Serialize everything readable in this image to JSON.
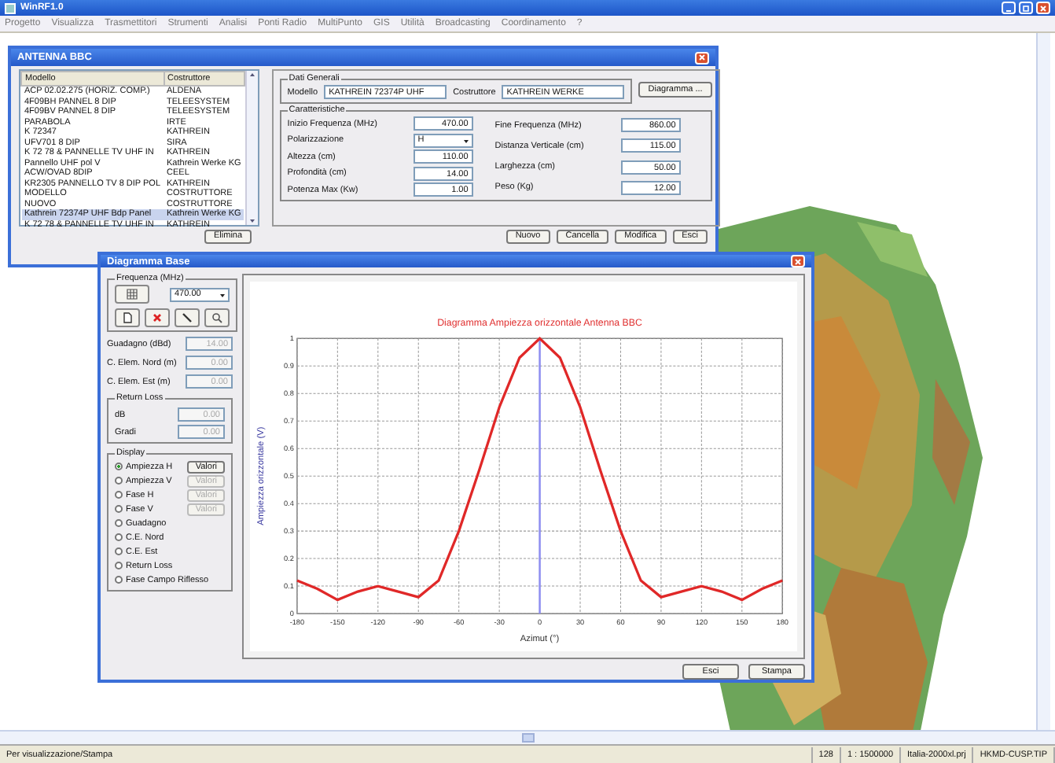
{
  "app": {
    "title": "WinRF1.0",
    "menu": [
      "Progetto",
      "Visualizza",
      "Trasmettitori",
      "Strumenti",
      "Analisi",
      "Ponti Radio",
      "MultiPunto",
      "GIS",
      "Utilità",
      "Broadcasting",
      "Coordinamento",
      "?"
    ]
  },
  "antenna_dialog": {
    "title": "ANTENNA BBC",
    "list": {
      "columns": [
        "Modello",
        "Costruttore"
      ],
      "rows": [
        {
          "cells": [
            "ACP 02.02.275 (HORIZ. COMP.)",
            "ALDENA"
          ],
          "selected": false
        },
        {
          "cells": [
            "4F09BH PANNEL 8 DIP",
            "TELEESYSTEM"
          ],
          "selected": false
        },
        {
          "cells": [
            "4F09BV PANNEL 8 DIP",
            "TELEESYSTEM"
          ],
          "selected": false
        },
        {
          "cells": [
            "PARABOLA",
            "IRTE"
          ],
          "selected": false
        },
        {
          "cells": [
            "K 72347",
            "KATHREIN"
          ],
          "selected": false
        },
        {
          "cells": [
            "UFV701 8 DIP",
            "SIRA"
          ],
          "selected": false
        },
        {
          "cells": [
            "K 72 78 & PANNELLE TV UHF IN",
            "KATHREIN"
          ],
          "selected": false
        },
        {
          "cells": [
            "Pannello UHF pol V",
            "Kathrein Werke KG"
          ],
          "selected": false
        },
        {
          "cells": [
            "ACW/OVAD 8DIP",
            "CEEL"
          ],
          "selected": false
        },
        {
          "cells": [
            "KR2305 PANNELLO TV 8 DIP POL",
            "KATHREIN"
          ],
          "selected": false
        },
        {
          "cells": [
            "MODELLO",
            "COSTRUTTORE"
          ],
          "selected": false
        },
        {
          "cells": [
            "NUOVO",
            "COSTRUTTORE"
          ],
          "selected": false
        },
        {
          "cells": [
            "Kathrein 72374P UHF Bdp Panel",
            "Kathrein Werke KG"
          ],
          "selected": true
        },
        {
          "cells": [
            "K 72 78 & PANNELLE TV UHF IN",
            "KATHREIN"
          ],
          "selected": false
        }
      ]
    },
    "dati_generali": {
      "legend": "Dati Generali",
      "fields": [
        {
          "label": "Modello",
          "value": "KATHREIN 72374P UHF"
        },
        {
          "label": "Costruttore",
          "value": "KATHREIN WERKE"
        }
      ]
    },
    "diagram_button": "Diagramma ...",
    "caratteristiche": {
      "legend": "Caratteristiche",
      "left": [
        {
          "label": "Inizio Frequenza (MHz)",
          "value": "470.00",
          "kind": "text"
        },
        {
          "label": "Polarizzazione",
          "value": "H",
          "kind": "dropdown"
        },
        {
          "label": "Altezza (cm)",
          "value": "110.00",
          "kind": "text"
        },
        {
          "label": "Profondità (cm)",
          "value": "14.00",
          "kind": "text"
        },
        {
          "label": "Potenza Max (Kw)",
          "value": "1.00",
          "kind": "text"
        }
      ],
      "right": [
        {
          "label": "Fine Frequenza (MHz)",
          "value": "860.00",
          "kind": "text"
        },
        {
          "label": "Distanza Verticale (cm)",
          "value": "115.00",
          "kind": "text"
        },
        {
          "label": "Larghezza (cm)",
          "value": "50.00",
          "kind": "text"
        },
        {
          "label": "Peso (Kg)",
          "value": "12.00",
          "kind": "text"
        }
      ]
    },
    "list_button": "Elimina",
    "buttons": [
      "Nuovo",
      "Cancella",
      "Modifica",
      "Esci"
    ]
  },
  "diagram_dialog": {
    "title": "Diagramma Base",
    "frequency": {
      "legend": "Frequenza (MHz)",
      "value": "470.00"
    },
    "params": [
      {
        "label": "Guadagno (dBd)",
        "value": "14.00",
        "disabled": true
      },
      {
        "label": "C. Elem. Nord (m)",
        "value": "0.00",
        "disabled": true
      },
      {
        "label": "C. Elem. Est (m)",
        "value": "0.00",
        "disabled": true
      }
    ],
    "return_loss": {
      "legend": "Return Loss",
      "fields": [
        {
          "label": "dB",
          "value": "0.00",
          "disabled": true
        },
        {
          "label": "Gradi",
          "value": "0.00",
          "disabled": true
        }
      ]
    },
    "display": {
      "legend": "Display",
      "options": [
        {
          "label": "Ampiezza H",
          "selected": true,
          "button": {
            "label": "Valori",
            "disabled": false
          }
        },
        {
          "label": "Ampiezza V",
          "selected": false,
          "button": {
            "label": "Valori",
            "disabled": true
          }
        },
        {
          "label": "Fase H",
          "selected": false,
          "button": {
            "label": "Valori",
            "disabled": true
          }
        },
        {
          "label": "Fase V",
          "selected": false,
          "button": {
            "label": "Valori",
            "disabled": true
          }
        },
        {
          "label": "Guadagno",
          "selected": false
        },
        {
          "label": "C.E. Nord",
          "selected": false
        },
        {
          "label": "C.E. Est",
          "selected": false
        },
        {
          "label": "Return Loss",
          "selected": false
        },
        {
          "label": "Fase Campo Riflesso",
          "selected": false
        }
      ]
    },
    "chart": {
      "chart_data": {
        "type": "line",
        "title": "Diagramma Ampiezza orizzontale Antenna BBC",
        "xlabel": "Azimut (°)",
        "ylabel": "Ampiezza orizzontale (V)",
        "x": [
          -180,
          -165,
          -150,
          -135,
          -120,
          -105,
          -90,
          -75,
          -60,
          -45,
          -30,
          -15,
          0,
          15,
          30,
          45,
          60,
          75,
          90,
          105,
          120,
          135,
          150,
          165,
          180
        ],
        "series": [
          {
            "color": "#e02828",
            "values": [
              0.12,
              0.09,
              0.05,
              0.08,
              0.1,
              0.08,
              0.06,
              0.12,
              0.3,
              0.52,
              0.75,
              0.93,
              1.0,
              0.93,
              0.75,
              0.52,
              0.3,
              0.12,
              0.06,
              0.08,
              0.1,
              0.08,
              0.05,
              0.09,
              0.12
            ]
          }
        ],
        "xlim": [
          -180,
          180
        ],
        "ylim": [
          0,
          1
        ],
        "xticks": [
          -180,
          -150,
          -120,
          -90,
          -60,
          -30,
          0,
          30,
          60,
          90,
          120,
          150,
          180
        ],
        "yticks": [
          0,
          0.1,
          0.2,
          0.3,
          0.4,
          0.5,
          0.6,
          0.7,
          0.8,
          0.9,
          1
        ],
        "grid": true,
        "ref_lines": [
          {
            "axis": "x",
            "value": 0,
            "color": "#8c8cf0"
          }
        ]
      }
    },
    "buttons": [
      "Esci",
      "Stampa"
    ]
  },
  "status_bar": [
    "Per visualizzazione/Stampa",
    "128",
    "1 : 1500000",
    "Italia-2000xl.prj",
    "HKMD-CUSP.TIP"
  ]
}
